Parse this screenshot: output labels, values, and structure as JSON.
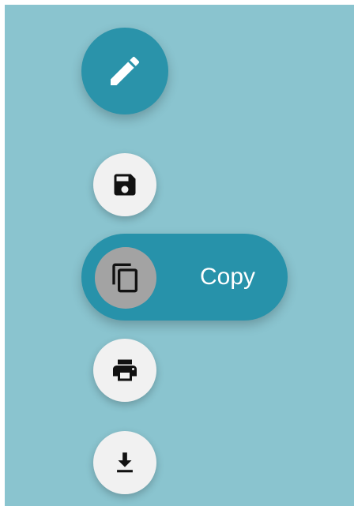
{
  "speed_dial": {
    "main": {
      "icon": "pencil-icon",
      "color": "#2a93aa"
    },
    "actions": [
      {
        "id": "save",
        "icon": "floppy-disk-icon",
        "label": ""
      },
      {
        "id": "copy",
        "icon": "copy-icon",
        "label": "Copy",
        "active": true
      },
      {
        "id": "print",
        "icon": "printer-icon",
        "label": ""
      },
      {
        "id": "download",
        "icon": "download-icon",
        "label": ""
      }
    ]
  },
  "colors": {
    "background": "#8ac4cf",
    "accent": "#2a93aa",
    "mini_fab": "#f1f1f1",
    "active_icon_bg": "#a3a3a3"
  }
}
